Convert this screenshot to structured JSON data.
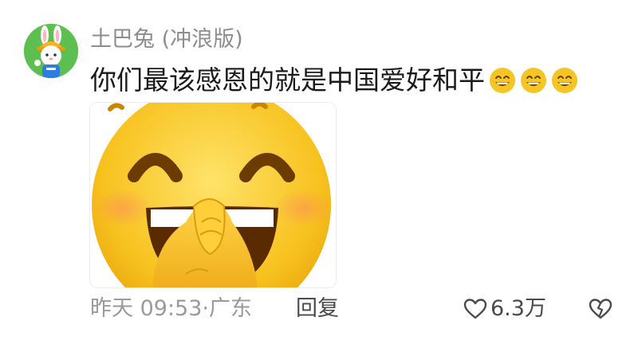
{
  "comment": {
    "username": "土巴兔 (冲浪版)",
    "text": "你们最该感恩的就是中国爱好和平",
    "emoji_icons": [
      "grinning-face-icon",
      "grinning-face-icon",
      "grinning-face-icon"
    ],
    "sticker": "shy-laughing-emoji-sticker",
    "timestamp": "昨天 09:53·广东",
    "reply_label": "回复",
    "like_count": "6.3万",
    "colors": {
      "username": "#8d8d8d",
      "text": "#1a1a1a",
      "meta": "#9a9a9a",
      "action": "#4a4a4a",
      "avatar_bg": "#5cbf4f",
      "emoji_yellow": "#f5c623"
    }
  }
}
